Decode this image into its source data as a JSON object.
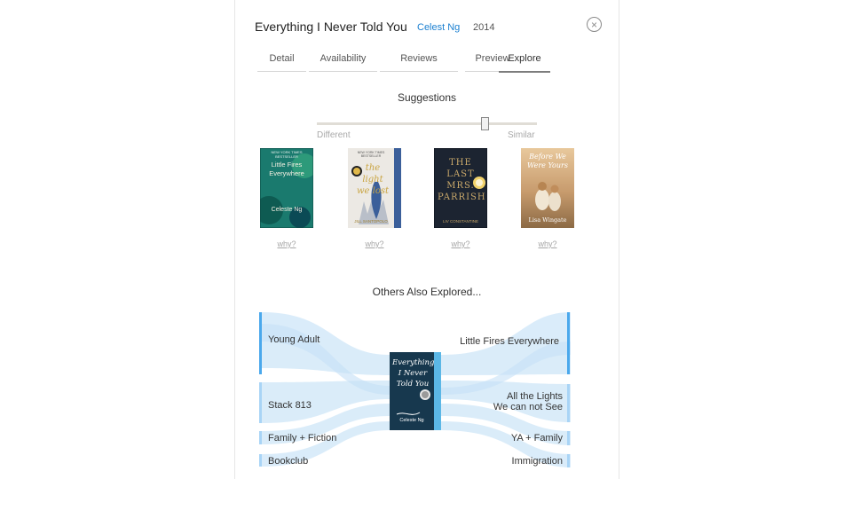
{
  "header": {
    "title": "Everything I Never Told You",
    "author": "Celest Ng",
    "year": "2014",
    "close_icon": "close-circle-icon"
  },
  "tabs": [
    {
      "label": "Detail",
      "active": false
    },
    {
      "label": "Availability",
      "active": false
    },
    {
      "label": "Reviews",
      "active": false
    },
    {
      "label": "Preview",
      "active": false
    },
    {
      "label": "Explore",
      "active": true
    }
  ],
  "suggestions": {
    "title": "Suggestions",
    "slider": {
      "left_label": "Different",
      "right_label": "Similar",
      "value_fraction": 0.77
    },
    "books": [
      {
        "cover_top": "NEW YORK TIMES BESTSELLER",
        "cover_title": "Little Fires Everywhere",
        "cover_author": "Celeste Ng",
        "why": "why?",
        "bg": "#1a7a6e"
      },
      {
        "cover_top": "NEW YORK TIMES BESTSELLER",
        "cover_title": "the light we lost",
        "cover_author": "JILL SANTOPOLO",
        "why": "why?",
        "bg": "#e8e6e2"
      },
      {
        "cover_top": "",
        "cover_title": "THE LAST MRS. PARRISH",
        "cover_author": "LIV CONSTANTINE",
        "why": "why?",
        "bg": "#1c2431"
      },
      {
        "cover_top": "",
        "cover_title": "Before We Were Yours",
        "cover_author": "Lisa Wingate",
        "why": "why?",
        "bg": "#c9a27a"
      }
    ]
  },
  "others": {
    "title": "Others Also Explored...",
    "left": [
      {
        "label": "Young Adult"
      },
      {
        "label": "Stack 813"
      },
      {
        "label": "Family + Fiction"
      },
      {
        "label": "Bookclub"
      }
    ],
    "right": [
      {
        "label": "Little Fires Everywhere"
      },
      {
        "label_line1": "All the Lights",
        "label_line2": "We can not See"
      },
      {
        "label": "YA + Family"
      },
      {
        "label": "Immigration"
      }
    ],
    "center_book": {
      "cover_title": "Everything I Never Told You",
      "cover_author": "Celeste Ng",
      "bg": "#17384e"
    }
  },
  "colors": {
    "accent": "#1a7fd0",
    "flow": "#cfe6f8",
    "bar_strong": "#4aa8ec",
    "bar_light": "#a9d4f6"
  }
}
